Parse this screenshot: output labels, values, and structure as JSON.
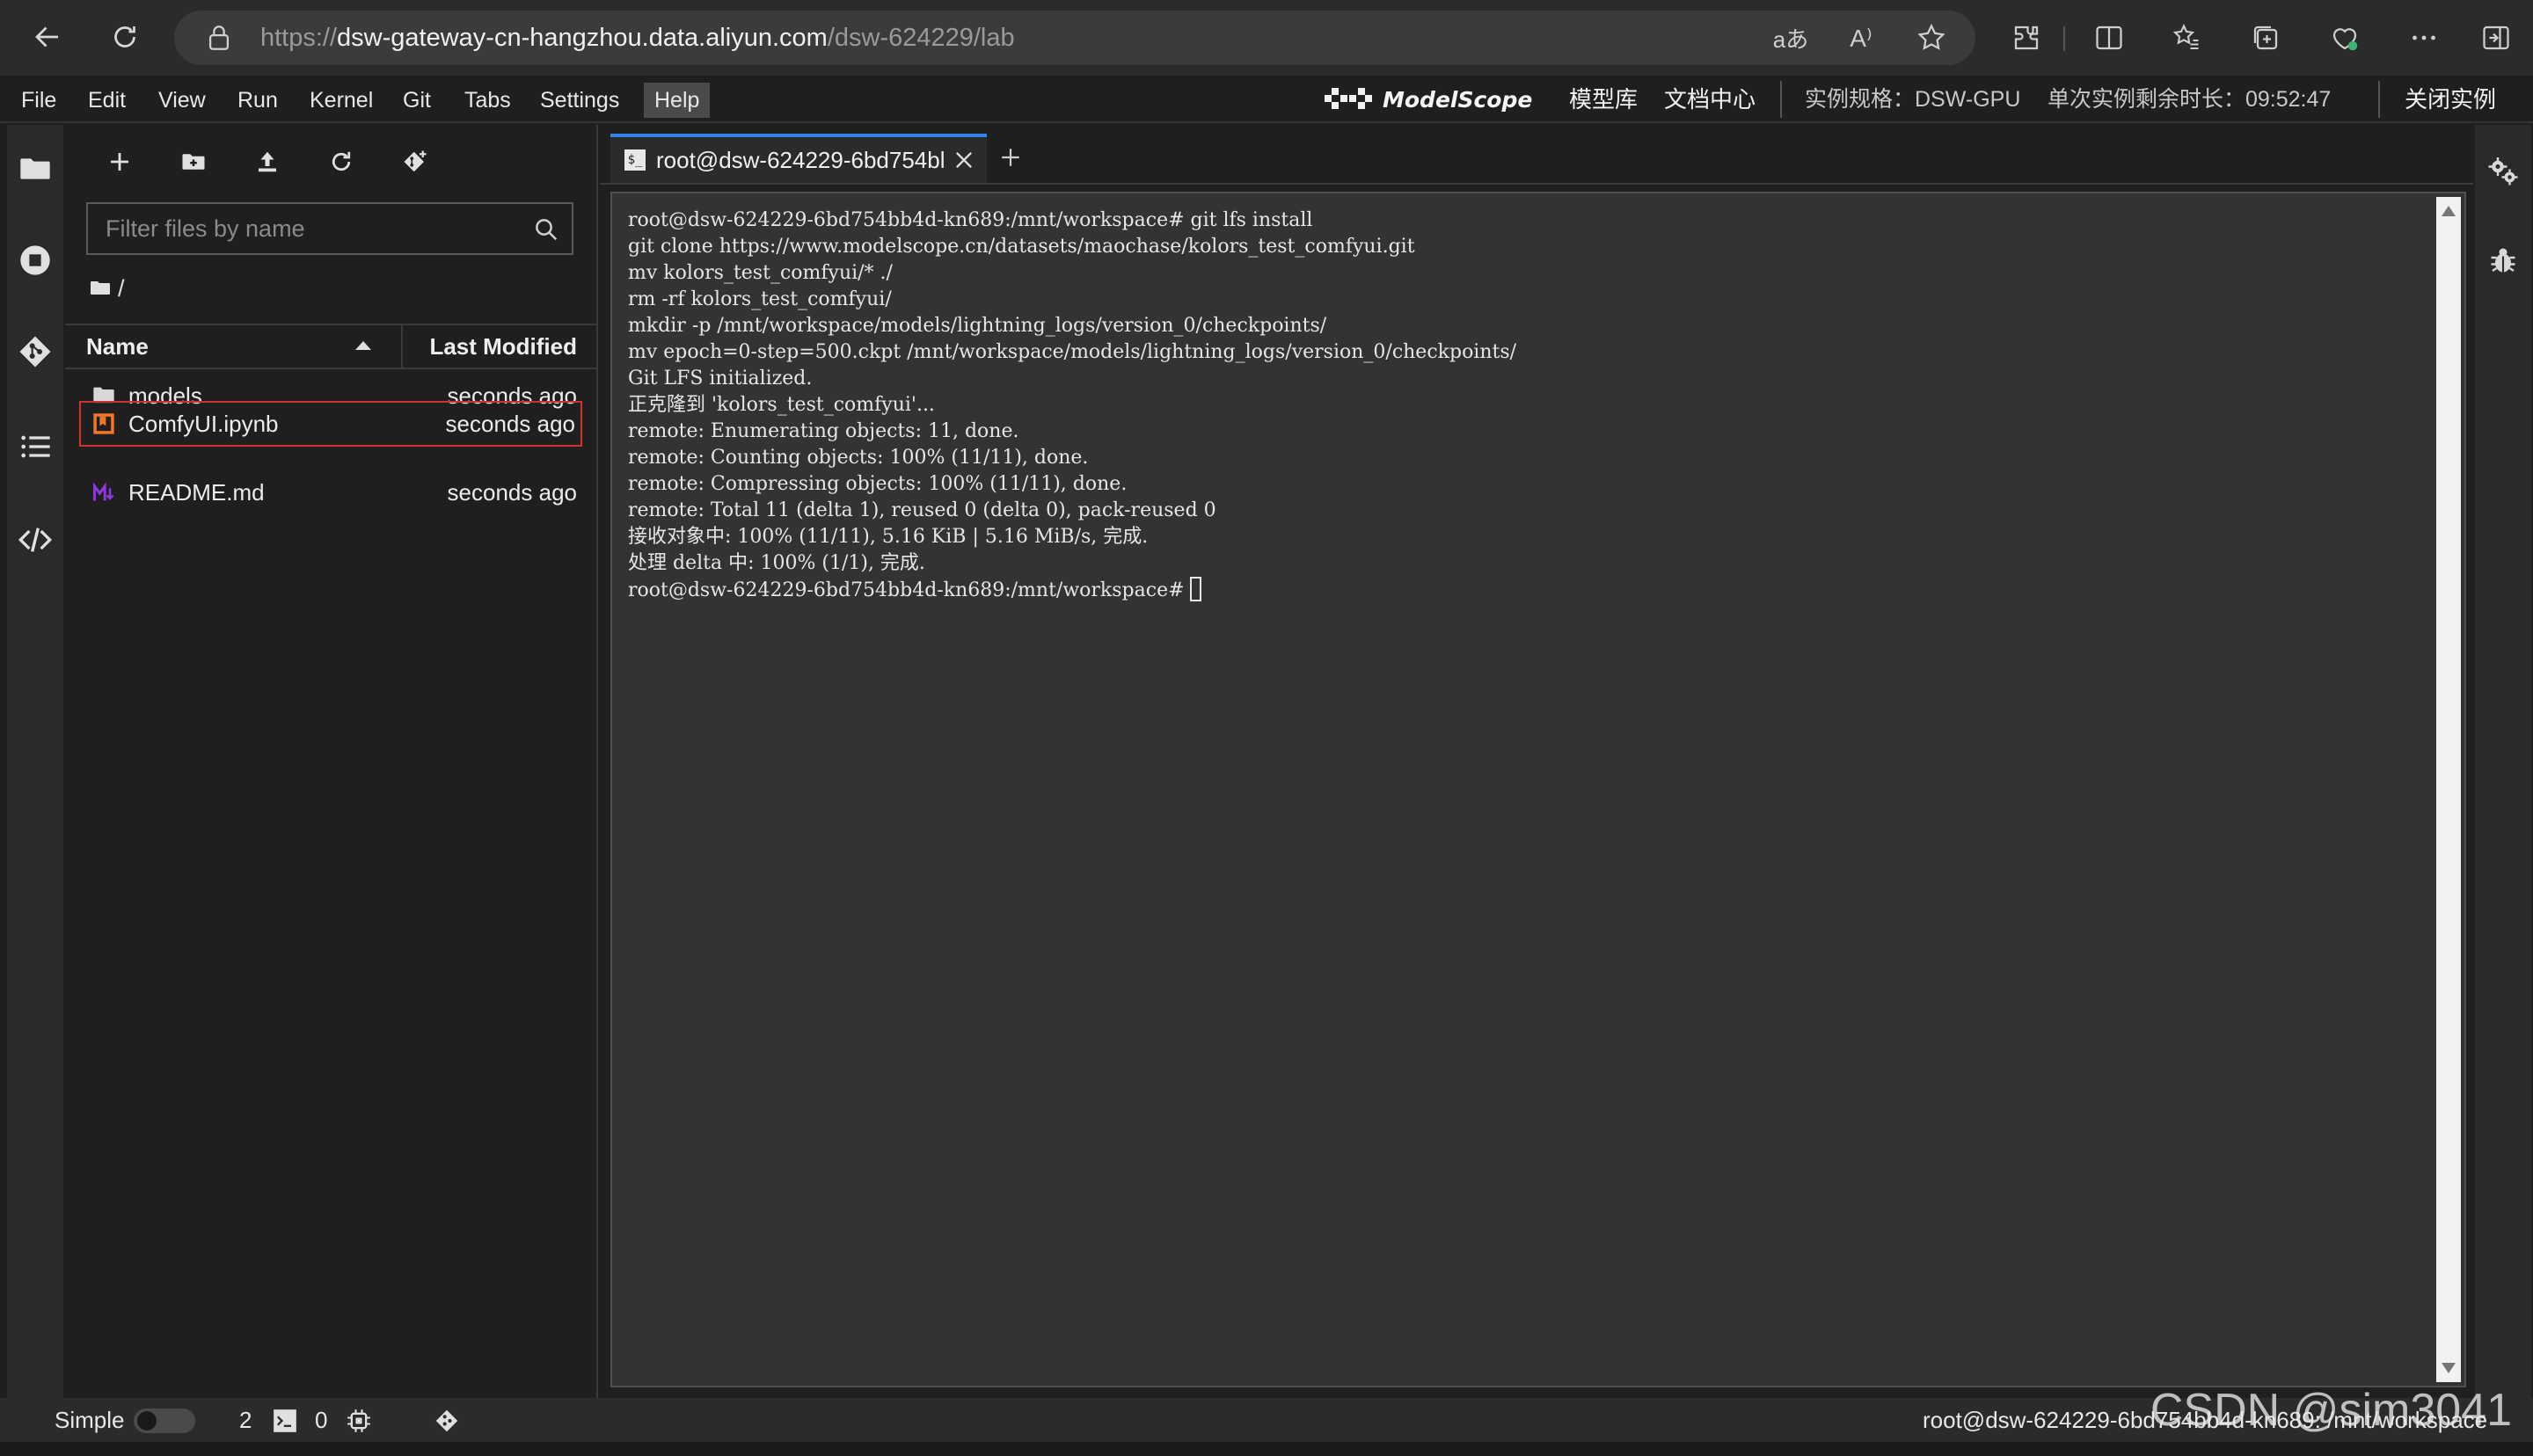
{
  "browser": {
    "url_scheme": "https://",
    "url_host": "dsw-gateway-cn-hangzhou.data.aliyun.com",
    "url_path": "/dsw-624229/lab",
    "translate_glyph": "aあ",
    "read_aloud_glyph": "A⁾"
  },
  "menu": [
    "File",
    "Edit",
    "View",
    "Run",
    "Kernel",
    "Git",
    "Tabs",
    "Settings",
    "Help"
  ],
  "header": {
    "brand": "ModelScope",
    "links": [
      "模型库",
      "文档中心"
    ],
    "spec": "实例规格：DSW-GPU",
    "remaining": "单次实例剩余时长：09:52:47",
    "close_instance": "关闭实例"
  },
  "file_browser": {
    "filter_placeholder": "Filter files by name",
    "breadcrumb": "/",
    "col_name": "Name",
    "col_modified": "Last Modified",
    "files": [
      {
        "name": "models",
        "modified": "seconds ago",
        "icon": "folder-icon"
      },
      {
        "name": "ComfyUI.ipynb",
        "modified": "seconds ago",
        "icon": "notebook-icon"
      },
      {
        "name": "README.md",
        "modified": "seconds ago",
        "icon": "markdown-icon"
      }
    ]
  },
  "terminal": {
    "tab_title": "root@dsw-624229-6bd754bl",
    "tab_icon": "$_",
    "lines": [
      "root@dsw-624229-6bd754bb4d-kn689:/mnt/workspace# git lfs install",
      "git clone https://www.modelscope.cn/datasets/maochase/kolors_test_comfyui.git",
      "mv kolors_test_comfyui/* ./",
      "rm -rf kolors_test_comfyui/",
      "mkdir -p /mnt/workspace/models/lightning_logs/version_0/checkpoints/",
      "mv epoch=0-step=500.ckpt /mnt/workspace/models/lightning_logs/version_0/checkpoints/",
      "Git LFS initialized.",
      "正克隆到 'kolors_test_comfyui'...",
      "remote: Enumerating objects: 11, done.",
      "remote: Counting objects: 100% (11/11), done.",
      "remote: Compressing objects: 100% (11/11), done.",
      "remote: Total 11 (delta 1), reused 0 (delta 0), pack-reused 0",
      "接收对象中: 100% (11/11), 5.16 KiB | 5.16 MiB/s, 完成.",
      "处理 delta 中: 100% (1/1), 完成."
    ],
    "prompt": "root@dsw-624229-6bd754bb4d-kn689:/mnt/workspace#"
  },
  "status_bar": {
    "mode": "Simple",
    "terminals_count": "2",
    "kernels_count": "0",
    "path": "root@dsw-624229-6bd754bb4d-kn689: /mnt/workspace"
  },
  "watermark": "CSDN @sim3041",
  "colors": {
    "accent": "#2f86e8",
    "selection_border": "#d03030",
    "notebook_icon": "#f37726",
    "markdown_icon": "#7b2fc9"
  }
}
